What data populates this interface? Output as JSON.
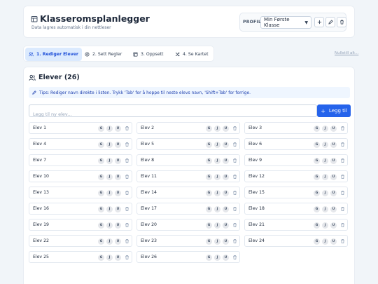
{
  "header": {
    "title": "Klasseromsplanlegger",
    "subtitle": "Data lagres automatisk i din nettleser",
    "profile_label": "PROFIL:",
    "profile_selected": "Min Første Klasse",
    "icons": [
      "calendar-icon",
      "plus-icon",
      "pencil-icon",
      "trash-icon"
    ]
  },
  "tabs": [
    {
      "label": "1. Rediger Elever",
      "icon": "users-icon"
    },
    {
      "label": "2. Sett Regler",
      "icon": "settings-icon"
    },
    {
      "label": "3. Oppsett",
      "icon": "layout-icon"
    },
    {
      "label": "4. Se Kartet",
      "icon": "shuffle-icon"
    }
  ],
  "reset_link": "Nullstill alt...",
  "section": {
    "title": "Elever (26)",
    "tip": "Tips: Rediger navn direkte i listen. Trykk 'Tab' for å hoppe til neste elevs navn, 'Shift+Tab' for forrige.",
    "add_placeholder": "Legg til ny elev...",
    "add_button": "Legg til"
  },
  "badges": {
    "g": "G",
    "j": "J",
    "u": "U"
  },
  "students": [
    "Elev 1",
    "Elev 2",
    "Elev 3",
    "Elev 4",
    "Elev 5",
    "Elev 6",
    "Elev 7",
    "Elev 8",
    "Elev 9",
    "Elev 10",
    "Elev 11",
    "Elev 12",
    "Elev 13",
    "Elev 14",
    "Elev 15",
    "Elev 16",
    "Elev 17",
    "Elev 18",
    "Elev 19",
    "Elev 20",
    "Elev 21",
    "Elev 22",
    "Elev 23",
    "Elev 24",
    "Elev 25",
    "Elev 26"
  ],
  "colors": {
    "accent": "#2563eb",
    "active_tab_bg": "#dbeafe",
    "tip_bg": "#eff6ff"
  }
}
